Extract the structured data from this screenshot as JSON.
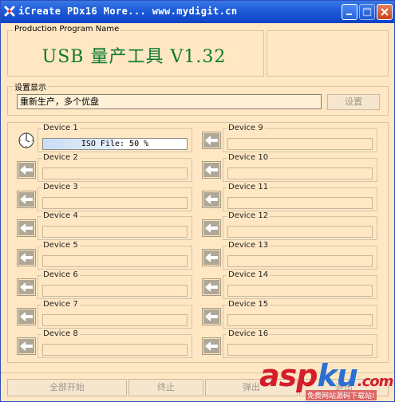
{
  "window": {
    "title": "iCreate PDx16    More...  www.mydigit.cn"
  },
  "program_group": {
    "label": "Production Program Name",
    "name": "USB 量产工具 V1.32"
  },
  "settings_group": {
    "label": "设置显示",
    "status": "重新生产，多个优盘",
    "button": "设置"
  },
  "devices_left": [
    {
      "label": "Device 1",
      "progress_text": "ISO File: 50 %",
      "progress": 50,
      "active": true
    },
    {
      "label": "Device 2",
      "progress_text": ""
    },
    {
      "label": "Device 3",
      "progress_text": ""
    },
    {
      "label": "Device 4",
      "progress_text": ""
    },
    {
      "label": "Device 5",
      "progress_text": ""
    },
    {
      "label": "Device 6",
      "progress_text": ""
    },
    {
      "label": "Device 7",
      "progress_text": ""
    },
    {
      "label": "Device 8",
      "progress_text": ""
    }
  ],
  "devices_right": [
    {
      "label": "Device 9",
      "progress_text": ""
    },
    {
      "label": "Device 10",
      "progress_text": ""
    },
    {
      "label": "Device 11",
      "progress_text": ""
    },
    {
      "label": "Device 12",
      "progress_text": ""
    },
    {
      "label": "Device 13",
      "progress_text": ""
    },
    {
      "label": "Device 14",
      "progress_text": ""
    },
    {
      "label": "Device 15",
      "progress_text": ""
    },
    {
      "label": "Device 16",
      "progress_text": ""
    }
  ],
  "footer": {
    "start_all": "全部开始",
    "stop": "终止",
    "eject": "弹出",
    "exit": "退出"
  },
  "watermark": {
    "brand_a": "asp",
    "brand_b": "ku",
    "brand_c": ".com",
    "subtitle": "免费网站源码下载站!"
  },
  "colors": {
    "title_green": "#0a7a2e",
    "window_bg": "#ffe7c3",
    "titlebar": "#1f5ed9"
  }
}
